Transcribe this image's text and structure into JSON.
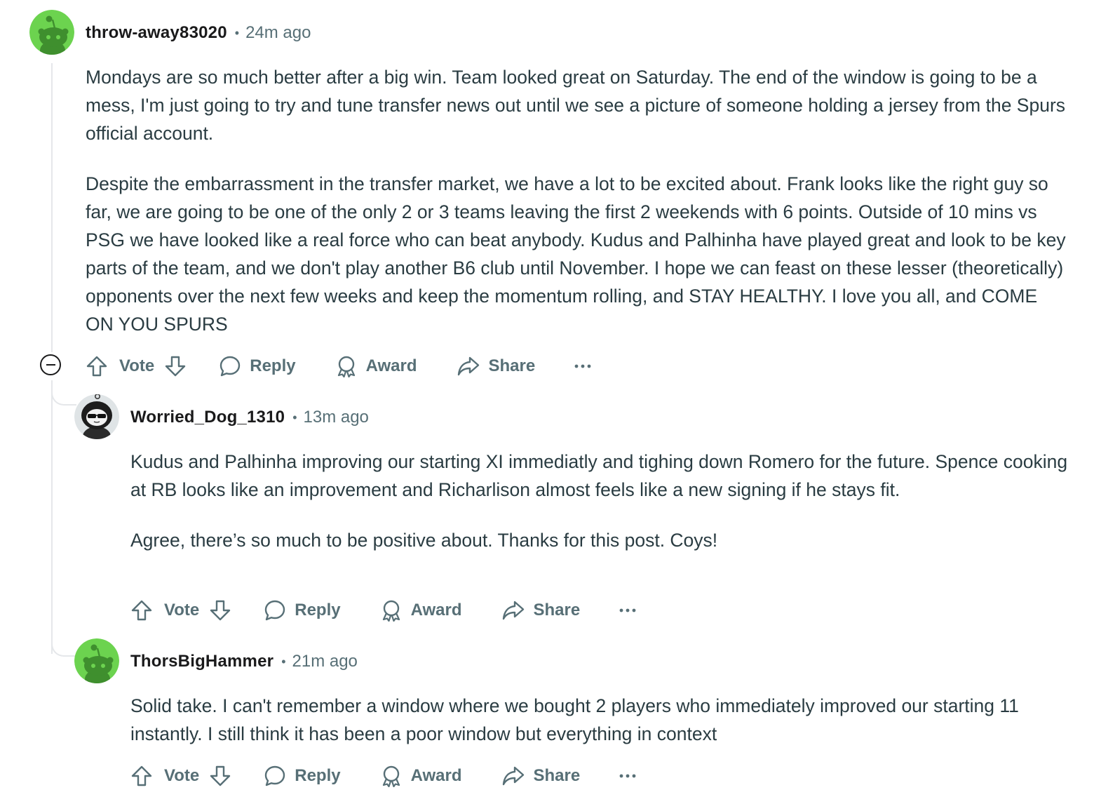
{
  "comments": [
    {
      "author": "throw-away83020",
      "time": "24m ago",
      "avatar_icon": "reddit-snoo-green-avatar",
      "paragraphs": [
        "Mondays are so much better after a big win. Team looked great on Saturday. The end of the window is going to be a mess, I'm just going to try and tune transfer news out until we see a picture of someone holding a jersey from the Spurs official account.",
        "Despite the embarrassment in the transfer market, we have a lot to be excited about. Frank looks like the right guy so far, we are going to be one of the only 2 or 3 teams leaving the first 2 weekends with 6 points. Outside of 10 mins vs PSG we have looked like a real force who can beat anybody. Kudus and Palhinha have played great and look to be key parts of the team, and we don't play another B6 club until November. I hope we can feast on these lesser (theoretically) opponents over the next few weeks and keep the momentum rolling, and STAY HEALTHY. I love you all, and COME ON YOU SPURS"
      ]
    },
    {
      "author": "Worried_Dog_1310",
      "time": "13m ago",
      "avatar_icon": "reddit-snoo-sunglasses-hood-avatar",
      "paragraphs": [
        "Kudus and Palhinha improving our starting XI immediatly and tighing down Romero for the future. Spence cooking at RB looks like an improvement and Richarlison almost feels like a new signing if he stays fit.",
        "Agree, there’s so much to be positive about. Thanks for this post. Coys!"
      ]
    },
    {
      "author": "ThorsBigHammer",
      "time": "21m ago",
      "avatar_icon": "reddit-snoo-green-avatar",
      "paragraphs": [
        "Solid take. I can't remember a window where we bought 2 players who immediately improved our starting 11 instantly. I still think it has been a poor window but everything in context"
      ]
    }
  ],
  "actions": {
    "vote": "Vote",
    "reply": "Reply",
    "award": "Award",
    "share": "Share",
    "more_icon": "ellipsis-icon"
  },
  "colors": {
    "avatar_green": "#6cd34f",
    "muted_text": "#576f76",
    "body_text": "#2a3c42",
    "thread_line": "#e5e7ea"
  },
  "separator": "•"
}
